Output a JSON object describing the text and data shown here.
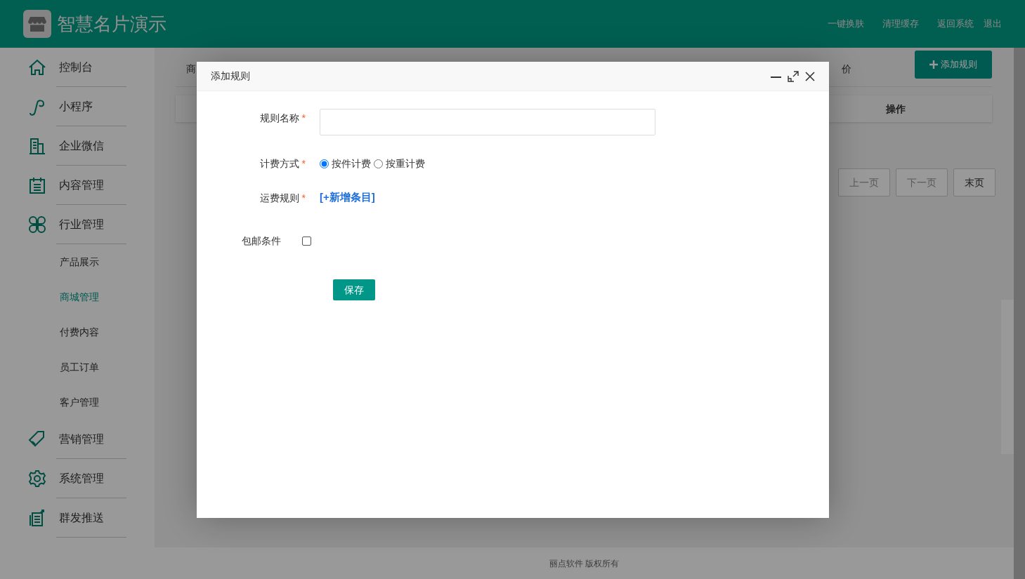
{
  "header": {
    "title": "智慧名片演示",
    "links": [
      "一键换肤",
      "清理缓存",
      "返回系统",
      "退出"
    ]
  },
  "sidebar": {
    "items": [
      {
        "label": "控制台",
        "selected": false
      },
      {
        "label": "小程序",
        "selected": false
      },
      {
        "label": "企业微信",
        "selected": false
      },
      {
        "label": "内容管理",
        "selected": false
      },
      {
        "label": "行业管理",
        "selected": false,
        "children": [
          {
            "label": "产品展示",
            "selected": false
          },
          {
            "label": "商城管理",
            "selected": true
          },
          {
            "label": "付费内容",
            "selected": false
          },
          {
            "label": "员工订单",
            "selected": false
          },
          {
            "label": "客户管理",
            "selected": false
          }
        ]
      },
      {
        "label": "营销管理",
        "selected": false
      },
      {
        "label": "系统管理",
        "selected": false
      },
      {
        "label": "群发推送",
        "selected": false
      }
    ]
  },
  "page": {
    "tabs": [
      {
        "label": "商"
      },
      {
        "label": "价"
      }
    ],
    "add_button": "添加规则",
    "table": {
      "columns": [
        "操作"
      ]
    },
    "pagination": [
      "上一页",
      "下一页",
      "末页"
    ],
    "footer": "丽点软件 版权所有"
  },
  "dialog": {
    "title": "添加规则",
    "fields": [
      {
        "kind": "text",
        "label": "规则名称",
        "required_mark": "*"
      },
      {
        "kind": "radio",
        "label": "计费方式",
        "required_mark": "*",
        "options": [
          {
            "label": "按件计费",
            "selected": true
          },
          {
            "label": "按重计费",
            "selected": false
          }
        ]
      },
      {
        "kind": "link",
        "label": "运费规则",
        "required_mark": "*",
        "link": "[+新增条目]"
      },
      {
        "kind": "checkbox",
        "label": "包邮条件",
        "checked": false
      }
    ],
    "save_button": "保存"
  }
}
